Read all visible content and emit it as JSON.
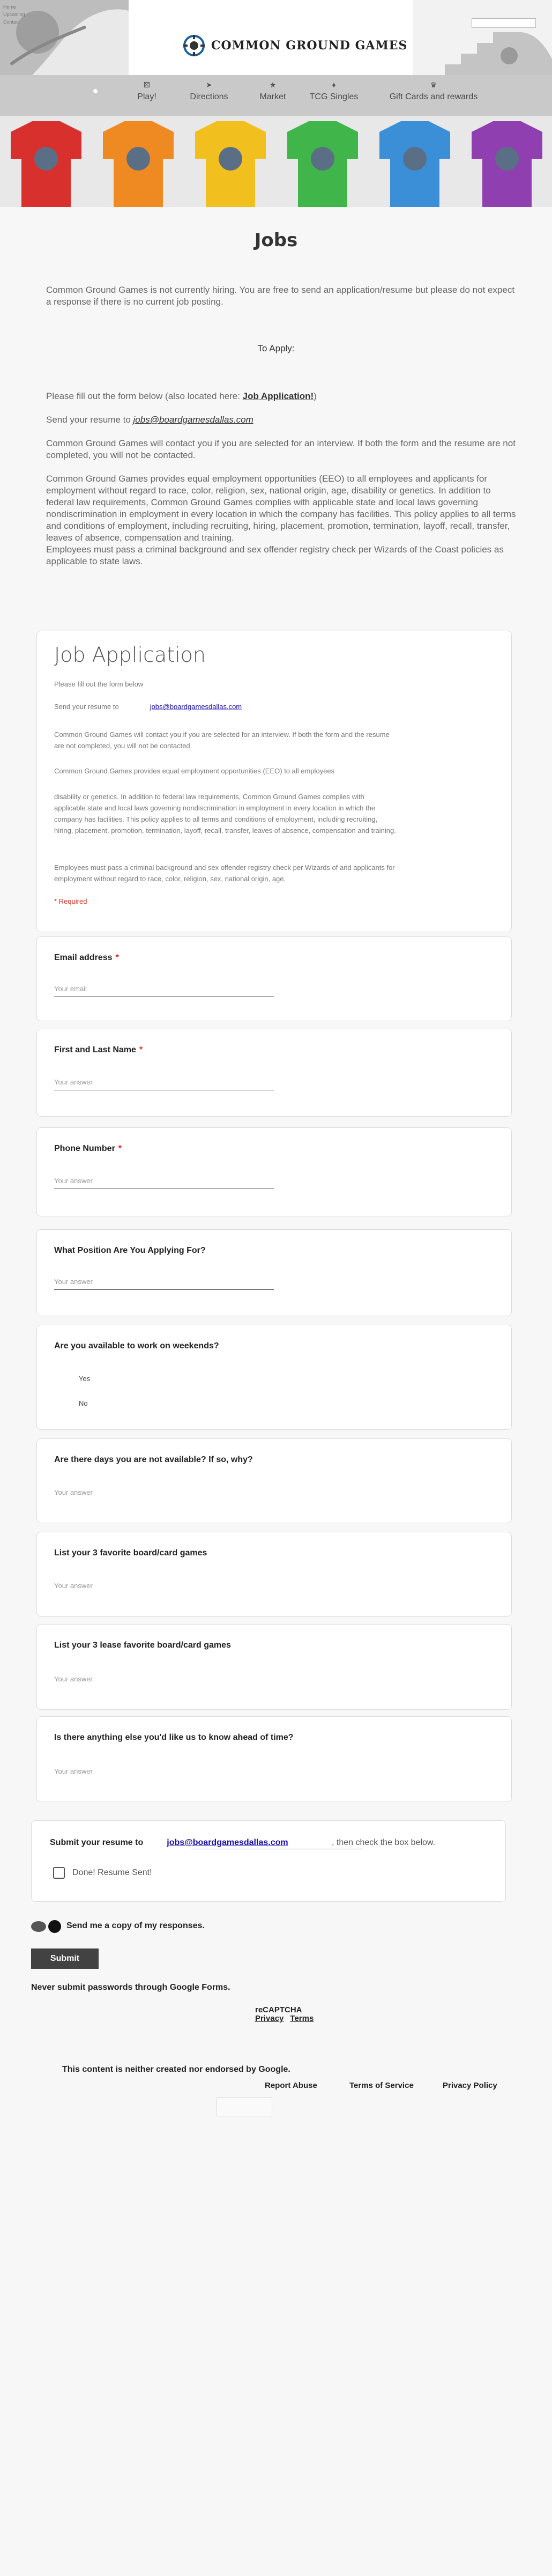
{
  "header": {
    "tiny_lines": [
      "Home",
      "Upcoming",
      "Contact"
    ],
    "logo_text": "COMMON GROUND GAMES",
    "search_placeholder": ""
  },
  "nav": {
    "items": [
      {
        "label": "Play!",
        "icon": "dice-icon"
      },
      {
        "label": "Directions",
        "icon": "compass-icon"
      },
      {
        "label": "Market",
        "icon": "star-icon"
      },
      {
        "label": "TCG Singles",
        "icon": "cards-icon"
      },
      {
        "label": "Gift Cards and rewards",
        "icon": "gift-icon"
      }
    ]
  },
  "shirts": {
    "colors": [
      "#d8302c",
      "#ef8a22",
      "#f2c01e",
      "#3fb54a",
      "#3b8fd6",
      "#8f3fb0"
    ]
  },
  "page": {
    "title": "Jobs",
    "intro": "Common Ground Games is not currently hiring. You are free to send an application/resume but please do not expect a response if there is no current job posting.",
    "to_apply": "To Apply:",
    "fill_prefix": "Please fill out the form below (also located here: ",
    "fill_link": "Job Application!",
    "fill_suffix": ")",
    "send_prefix": "Send your resume to ",
    "send_email": "jobs@boardgamesdallas.com",
    "contact_note": "Common Ground Games will contact you if you are selected for an interview. If both the form and the resume are not completed, you will not be contacted.",
    "eeo": "Common Ground Games provides equal employment opportunities (EEO) to all employees and applicants for employment without regard to race, color, religion, sex, national origin, age, disability or genetics. In addition to federal law requirements, Common Ground Games complies with applicable state and local laws governing nondiscrimination in employment in every location in which the company has facilities. This policy applies to all terms and conditions of employment, including recruiting, hiring, placement, promotion, termination, layoff, recall, transfer, leaves of absence, compensation and training.",
    "background": "Employees must pass a criminal background and sex offender registry check per Wizards of the Coast policies as applicable to state laws."
  },
  "form": {
    "title": "Job Application",
    "fill_note": "Please fill out the form below",
    "send_prefix": "Send your resume to",
    "send_email": "jobs@boardgamesdallas.com",
    "contact_note": "Common Ground Games will contact you if you are selected for an interview. If both the form and the resume are not completed, you will not be contacted.",
    "eeo_short": "Common Ground Games provides equal employment opportunities (EEO) to all employees",
    "eeo_long": "disability or genetics. In addition to federal law requirements, Common Ground Games complies with applicable state and local laws governing nondiscrimination in employment in every location in which the company has facilities. This policy applies to all terms and conditions of employment, including recruiting, hiring, placement, promotion, termination, layoff, recall, transfer, leaves of absence, compensation and training.",
    "background": "Employees must pass a criminal background and sex offender registry check per Wizards of and applicants for employment without regard to race, color, religion, sex, national origin, age,",
    "required": "* Required",
    "questions": {
      "email": {
        "label": "Email address",
        "placeholder": "Your email"
      },
      "name": {
        "label": "First and Last Name",
        "placeholder": "Your answer"
      },
      "phone": {
        "label": "Phone Number",
        "placeholder": "Your answer"
      },
      "position": {
        "label": "What Position Are You Applying For?",
        "placeholder": "Your answer"
      },
      "weekends": {
        "label": "Are you available to work on weekends?",
        "options": [
          "Yes",
          "No"
        ]
      },
      "unavailable": {
        "label": "Are there days you are not available? If so, why?",
        "placeholder": "Your answer"
      },
      "favorite": {
        "label": "List your 3 favorite board/card games",
        "placeholder": "Your answer"
      },
      "least_favorite": {
        "label": "List your 3 lease favorite board/card games",
        "placeholder": "Your answer"
      },
      "anything_else": {
        "label": "Is there anything else you'd like us to know ahead of time?",
        "placeholder": "Your answer"
      }
    },
    "confirm": {
      "prefix": "Submit your resume to",
      "email": "jobs@boardgamesdallas.com",
      "suffix": ", then check the box below.",
      "checkbox_label": "Done! Resume Sent!"
    },
    "copy_label": "Send me a copy of my responses.",
    "submit": "Submit",
    "never": "Never submit passwords through Google Forms.",
    "recaptcha": "reCAPTCHA",
    "privacy": "Privacy",
    "terms": "Terms",
    "endorse": "This content is neither created nor endorsed by Google.",
    "report": "Report Abuse",
    "tos": "Terms of Service",
    "privacy_policy": "Privacy Policy"
  }
}
